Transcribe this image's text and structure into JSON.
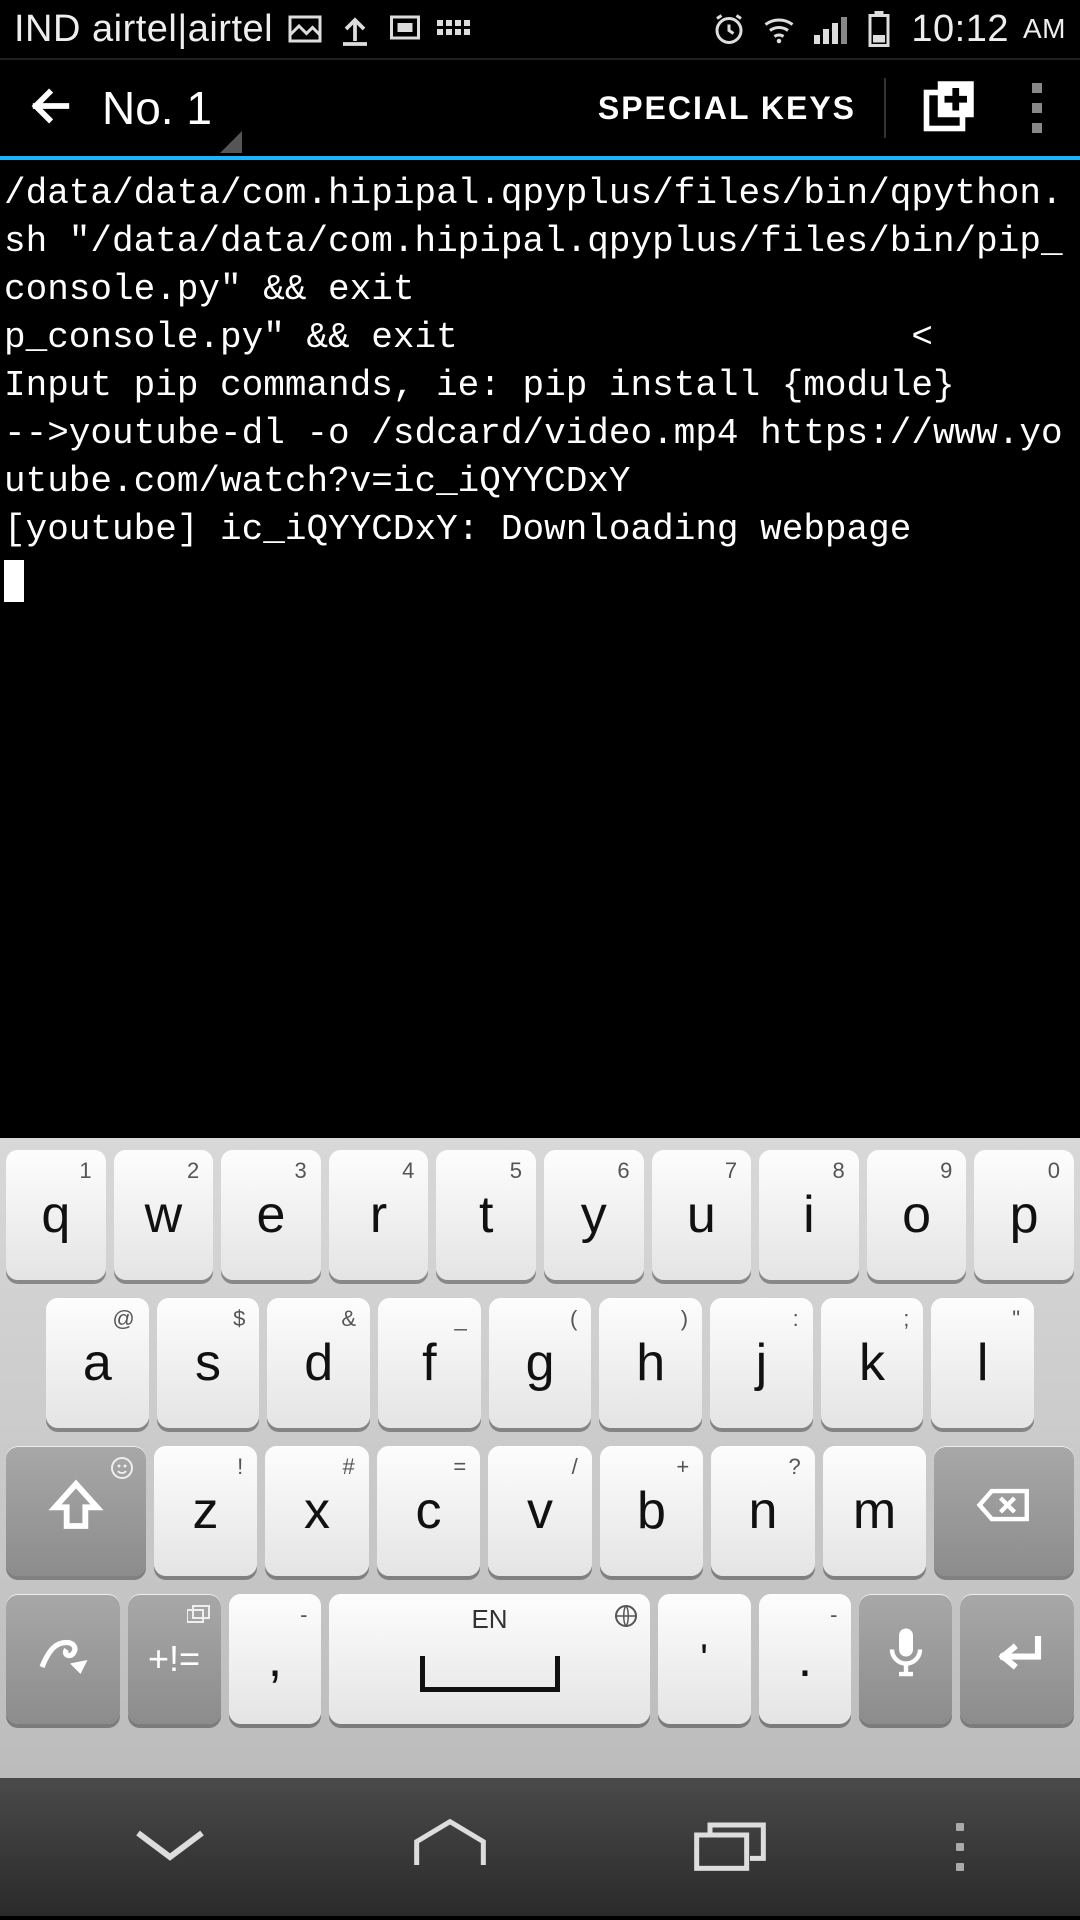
{
  "status": {
    "carrier": "IND airtel|airtel",
    "time": "10:12",
    "ampm": "AM"
  },
  "appbar": {
    "title": "No. 1",
    "special_keys": "SPECIAL KEYS"
  },
  "terminal": {
    "content": "/data/data/com.hipipal.qpyplus/files/bin/qpython.sh \"/data/data/com.hipipal.qpyplus/files/bin/pip_console.py\" && exit\np_console.py\" && exit                     <\nInput pip commands, ie: pip install {module}\n-->youtube-dl -o /sdcard/video.mp4 https://www.youtube.com/watch?v=ic_iQYYCDxY\n[youtube] ic_iQYYCDxY: Downloading webpage\n"
  },
  "keyboard": {
    "row1": [
      {
        "main": "q",
        "sub": "1"
      },
      {
        "main": "w",
        "sub": "2"
      },
      {
        "main": "e",
        "sub": "3"
      },
      {
        "main": "r",
        "sub": "4"
      },
      {
        "main": "t",
        "sub": "5"
      },
      {
        "main": "y",
        "sub": "6"
      },
      {
        "main": "u",
        "sub": "7"
      },
      {
        "main": "i",
        "sub": "8"
      },
      {
        "main": "o",
        "sub": "9"
      },
      {
        "main": "p",
        "sub": "0"
      }
    ],
    "row2": [
      {
        "main": "a",
        "sub": "@"
      },
      {
        "main": "s",
        "sub": "$"
      },
      {
        "main": "d",
        "sub": "&"
      },
      {
        "main": "f",
        "sub": "_"
      },
      {
        "main": "g",
        "sub": "("
      },
      {
        "main": "h",
        "sub": ")"
      },
      {
        "main": "j",
        "sub": ":"
      },
      {
        "main": "k",
        "sub": ";"
      },
      {
        "main": "l",
        "sub": "\""
      }
    ],
    "row3": [
      {
        "main": "z",
        "sub": "!"
      },
      {
        "main": "x",
        "sub": "#"
      },
      {
        "main": "c",
        "sub": "="
      },
      {
        "main": "v",
        "sub": "/"
      },
      {
        "main": "b",
        "sub": "+"
      },
      {
        "main": "n",
        "sub": "?"
      },
      {
        "main": "m",
        "sub": ""
      }
    ],
    "sym_label": "+!=",
    "comma": ",",
    "period": ".",
    "quote": "'",
    "space_lang": "EN"
  }
}
